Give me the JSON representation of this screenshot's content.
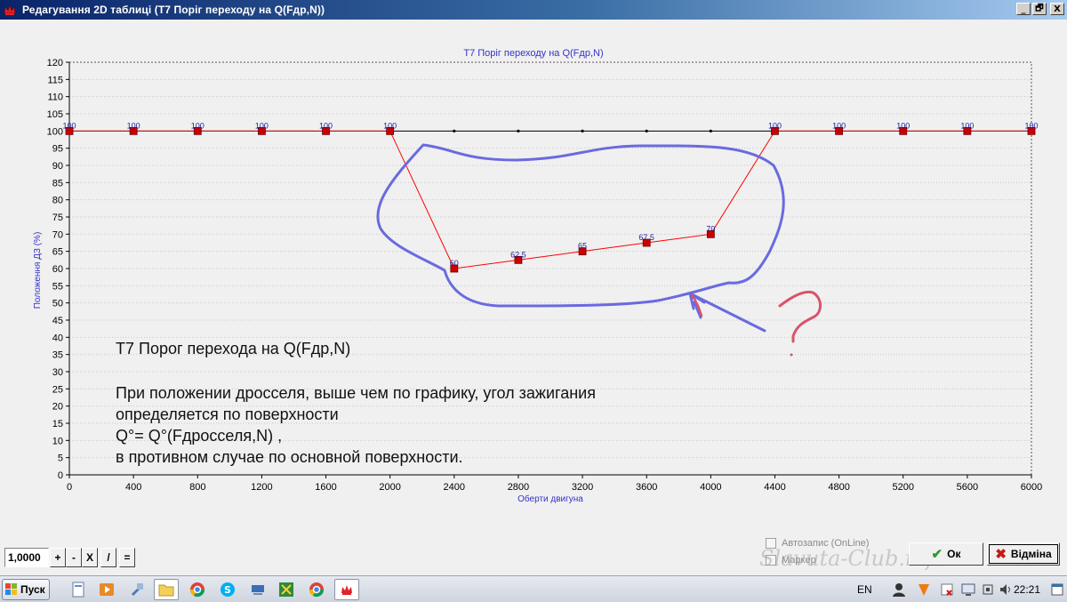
{
  "window": {
    "title": "Редагування 2D таблиці (Т7 Поріг переходу на Q(Fдр,N))",
    "buttons": [
      "_",
      "🗗",
      "X"
    ]
  },
  "chart_data": {
    "type": "line",
    "title": "Т7 Поріг переходу на Q(Fдр,N)",
    "xlabel": "Оберти двигуна",
    "ylabel": "Положення ДЗ (%)",
    "ylim": [
      0,
      120
    ],
    "y_ticks": [
      0,
      5,
      10,
      15,
      20,
      25,
      30,
      35,
      40,
      45,
      50,
      55,
      60,
      65,
      70,
      75,
      80,
      85,
      90,
      95,
      100,
      105,
      110,
      115,
      120
    ],
    "x_ticks": [
      0,
      400,
      800,
      1200,
      1600,
      2000,
      2400,
      2800,
      3200,
      3600,
      4000,
      4400,
      4800,
      5200,
      5600,
      6000
    ],
    "x": [
      0,
      400,
      800,
      1200,
      1600,
      2000,
      2400,
      2800,
      3200,
      3600,
      4000,
      4400,
      4800,
      5200,
      5600,
      6000
    ],
    "values": [
      100,
      100,
      100,
      100,
      100,
      100,
      60,
      62.5,
      65,
      67.5,
      70,
      100,
      100,
      100,
      100,
      100
    ],
    "point_labels": [
      "100",
      "100",
      "100",
      "100",
      "100",
      "100",
      "60",
      "62.5",
      "65",
      "67.5",
      "70",
      "100",
      "100",
      "100",
      "100",
      "100"
    ],
    "reference_line": {
      "y": 100,
      "color": "#000000"
    },
    "grid": true,
    "colors": {
      "series": "#ff0000",
      "marker": "#cc0000",
      "labels": "#1f1f9a",
      "axis_text": "#3333cc"
    }
  },
  "annotation": {
    "heading": "Т7 Порог перехода на Q(Fдр,N)",
    "lines": [
      "При положении дросселя, выше чем по графику, угол зажигания",
      "определяется по поверхности",
      "Q°= Q°(Fдросселя,N) ,",
      "в противном случае по основной поверхности."
    ],
    "handwritten_mark": "?"
  },
  "controls": {
    "value": "1,0000",
    "ops": [
      "+",
      "-",
      "X",
      "/",
      "="
    ],
    "autosave_label": "Автозапис (OnLine)",
    "autosave_checked": false,
    "marker_label": "Маркер",
    "marker_checked": false,
    "ok_label": "Ок",
    "cancel_label": "Відміна"
  },
  "watermark": "Slavuta-Club.info",
  "taskbar": {
    "start_label": "Пуск",
    "lang": "EN",
    "time": "22:21"
  }
}
